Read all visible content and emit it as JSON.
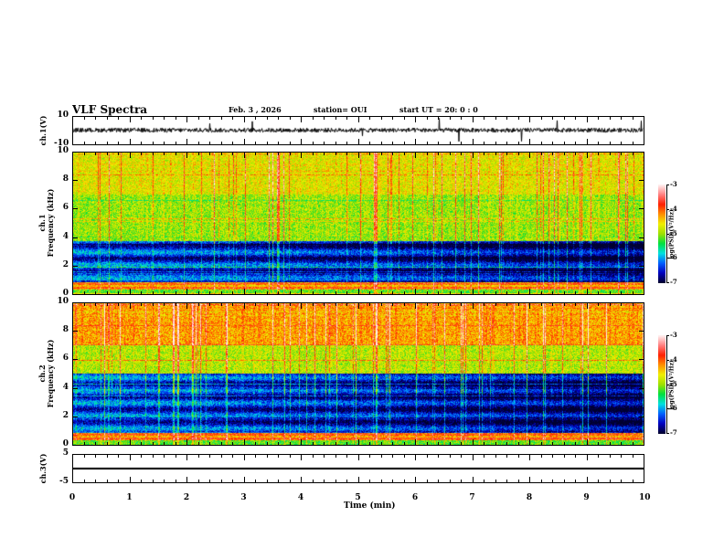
{
  "header": {
    "title": "VLF Spectra",
    "date": "Feb. 3  , 2026",
    "station": "station= OUI",
    "start": "start  UT  =   20: 0  : 0"
  },
  "chart_data": {
    "type": "heatmap",
    "xlabel": "Time  (min)",
    "xlim": [
      0,
      10
    ],
    "xticks": [
      "0",
      "1",
      "2",
      "3",
      "4",
      "5",
      "6",
      "7",
      "8",
      "9",
      "10"
    ],
    "panels": [
      {
        "id": "ch1-waveform",
        "type": "line",
        "ylabel": "ch.1(V)",
        "ylim": [
          -10,
          10
        ],
        "yticks": [
          "10",
          "-10"
        ]
      },
      {
        "id": "ch1-spectrogram",
        "type": "heatmap",
        "ylabel_top": "ch.1",
        "ylabel": "Frequency  (kHz)",
        "ylim": [
          0,
          10
        ],
        "yticks": [
          "10",
          "8",
          "6",
          "4",
          "2",
          "0"
        ],
        "colorbar": {
          "label": "log(PSD)(V²/Hz)",
          "range": [
            -7,
            -3
          ],
          "ticks": [
            "-3",
            "-4",
            "-5",
            "-6",
            "-7"
          ]
        }
      },
      {
        "id": "ch2-spectrogram",
        "type": "heatmap",
        "ylabel_top": "ch.2",
        "ylabel": "Frequency  (kHz)",
        "ylim": [
          0,
          10
        ],
        "yticks": [
          "10",
          "8",
          "6",
          "4",
          "2",
          "0"
        ],
        "colorbar": {
          "label": "log(PSD)(V²/Hz)",
          "range": [
            -7,
            -3
          ],
          "ticks": [
            "-3",
            "-4",
            "-5",
            "-6",
            "-7"
          ]
        }
      },
      {
        "id": "ch3-waveform",
        "type": "line",
        "ylabel": "ch.3(V)",
        "ylim": [
          -5,
          5
        ],
        "yticks": [
          "5",
          "-5"
        ],
        "constant_value": 0
      }
    ],
    "colormap": [
      "#000030",
      "#0000c0",
      "#0060ff",
      "#00e0e0",
      "#00e040",
      "#a0e000",
      "#f0f000",
      "#ff9000",
      "#ff2000",
      "#ff8080",
      "#fff0f0"
    ]
  }
}
